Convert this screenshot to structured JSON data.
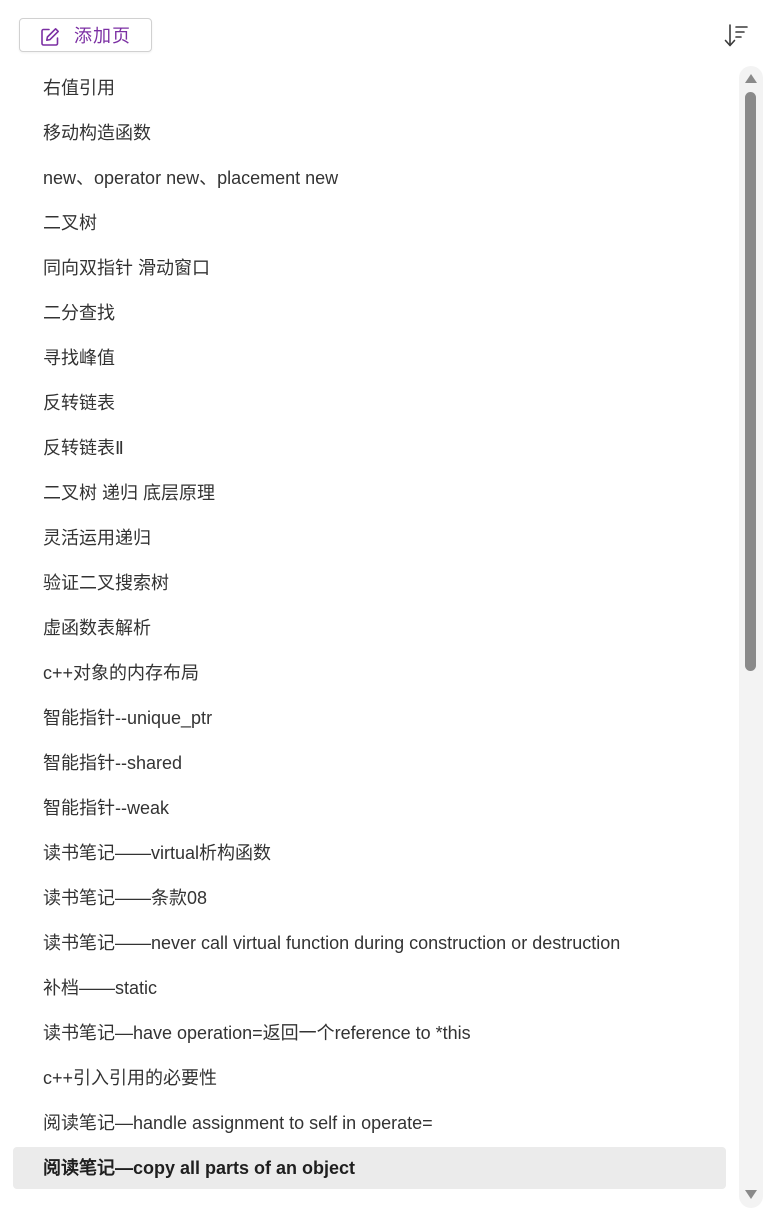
{
  "toolbar": {
    "add_page_label": "添加页",
    "add_page_icon": "edit-note-icon",
    "sort_icon": "sort-descending-icon",
    "accent_color": "#7b2fa3"
  },
  "pages": [
    {
      "title": "右值引用",
      "selected": false
    },
    {
      "title": "移动构造函数",
      "selected": false
    },
    {
      "title": "new、operator new、placement new",
      "selected": false
    },
    {
      "title": "二叉树",
      "selected": false
    },
    {
      "title": "同向双指针 滑动窗口",
      "selected": false
    },
    {
      "title": "二分查找",
      "selected": false
    },
    {
      "title": "寻找峰值",
      "selected": false
    },
    {
      "title": "反转链表",
      "selected": false
    },
    {
      "title": "反转链表Ⅱ",
      "selected": false
    },
    {
      "title": "二叉树 递归 底层原理",
      "selected": false
    },
    {
      "title": "灵活运用递归",
      "selected": false
    },
    {
      "title": "验证二叉搜索树",
      "selected": false
    },
    {
      "title": "虚函数表解析",
      "selected": false
    },
    {
      "title": "c++对象的内存布局",
      "selected": false
    },
    {
      "title": "智能指针--unique_ptr",
      "selected": false
    },
    {
      "title": "智能指针--shared",
      "selected": false
    },
    {
      "title": "智能指针--weak",
      "selected": false
    },
    {
      "title": "读书笔记——virtual析构函数",
      "selected": false
    },
    {
      "title": "读书笔记——条款08",
      "selected": false
    },
    {
      "title": "读书笔记——never call virtual function during construction or destruction",
      "selected": false
    },
    {
      "title": "补档——static",
      "selected": false
    },
    {
      "title": "读书笔记—have operation=返回一个reference to *this",
      "selected": false
    },
    {
      "title": "c++引入引用的必要性",
      "selected": false
    },
    {
      "title": "阅读笔记—handle assignment to self in operate=",
      "selected": false
    },
    {
      "title": "阅读笔记—copy all parts of an object",
      "selected": true
    }
  ],
  "scrollbar": {
    "up_icon": "scroll-up-arrow-icon",
    "down_icon": "scroll-down-arrow-icon"
  }
}
